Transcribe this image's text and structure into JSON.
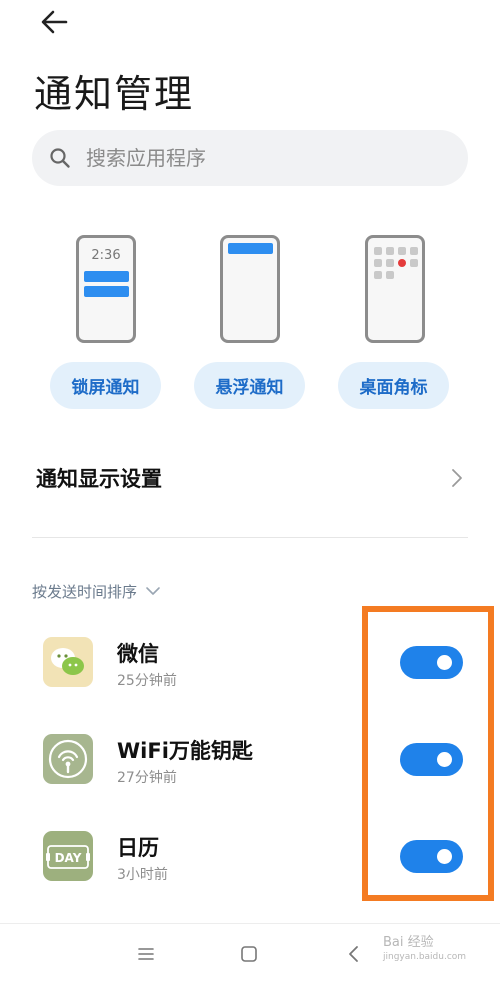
{
  "header": {
    "back_icon": "arrow-left-icon",
    "title": "通知管理"
  },
  "search": {
    "icon": "search-icon",
    "placeholder": "搜索应用程序"
  },
  "styles": {
    "lockscreen_preview_time": "2:36",
    "options": [
      {
        "label": "锁屏通知"
      },
      {
        "label": "悬浮通知"
      },
      {
        "label": "桌面角标"
      }
    ]
  },
  "display_settings": {
    "label": "通知显示设置",
    "chevron": "chevron-right-icon"
  },
  "sort": {
    "label": "按发送时间排序",
    "chevron": "chevron-down-icon"
  },
  "apps": [
    {
      "name": "微信",
      "time": "25分钟前",
      "enabled": true,
      "icon": "wechat-icon"
    },
    {
      "name": "WiFi万能钥匙",
      "time": "27分钟前",
      "enabled": true,
      "icon": "wifi-key-icon"
    },
    {
      "name": "日历",
      "time": "3小时前",
      "enabled": true,
      "icon": "calendar-icon",
      "icon_text": "DAY"
    }
  ],
  "nav": {
    "menu_icon": "menu-icon",
    "home_icon": "home-icon",
    "back_icon": "back-chevron-icon"
  },
  "watermark": {
    "brand": "Bai 经验",
    "url": "jingyan.baidu.com"
  },
  "colors": {
    "accent": "#1f82ea",
    "pill_bg": "#e3f0fb",
    "highlight": "#f47b22"
  }
}
